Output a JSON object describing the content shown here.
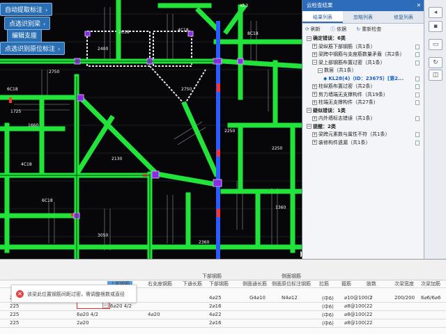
{
  "menu": {
    "items": [
      {
        "label": "自动提取标注",
        "chevron": true
      },
      {
        "label": "点选识别梁",
        "chevron": true
      },
      {
        "label": "编辑支座",
        "chevron": false
      },
      {
        "label": "点选识别原位标注",
        "chevron": true
      }
    ]
  },
  "cad": {
    "labels": [
      "KL3",
      "2400",
      "2750",
      "2750",
      "1360",
      "1725",
      "1660",
      "2130",
      "2250",
      "2250",
      "3050",
      "2360",
      "6C18",
      "4C18",
      "6C18",
      "2C18",
      "8C18",
      "4C18"
    ]
  },
  "panel": {
    "title": "云检查结果",
    "close": "✕",
    "tabs": [
      "结果列表",
      "忽略列表",
      "修复列表"
    ],
    "toolbar": {
      "refresh": "刷新",
      "basis": "依据",
      "recheck": "重新检查"
    },
    "tree": [
      {
        "level": 0,
        "label": "确定错误：6类",
        "bold": true,
        "exp": "−"
      },
      {
        "level": 1,
        "label": "梁纵筋下部钢筋（共1条）",
        "exp": "+"
      },
      {
        "level": 1,
        "label": "梁跨中钢筋与支座筋数量矛盾（共2条）",
        "exp": "+"
      },
      {
        "level": 1,
        "label": "梁上部钢筋布置过密（共1条）",
        "exp": "−"
      },
      {
        "level": 2,
        "label": "数层（共1条）",
        "exp": "−"
      },
      {
        "level": 3,
        "label": "KL28(4)（ID：23675）[第2...",
        "selected": true
      },
      {
        "level": 1,
        "label": "柱纵筋布置过密（共2条）",
        "exp": "+"
      },
      {
        "level": 1,
        "label": "剪力墙端无支撑构件（共19条）",
        "exp": "+"
      },
      {
        "level": 1,
        "label": "柱端无支撑构件（共27条）",
        "exp": "+"
      },
      {
        "level": 0,
        "label": "疑似错误：1类",
        "bold": true,
        "exp": "−"
      },
      {
        "level": 1,
        "label": "内外墙标志错误（共1条）",
        "exp": "+"
      },
      {
        "level": 0,
        "label": "提醒：2类",
        "bold": true,
        "exp": "−"
      },
      {
        "level": 1,
        "label": "梁跨元素数与属性不符（共1条）",
        "exp": "+"
      },
      {
        "level": 1,
        "label": "装修构件遗漏（共1条）",
        "exp": "+"
      }
    ]
  },
  "table": {
    "group_headers": [
      "下部钢筋",
      "侧面钢筋"
    ],
    "headers": [
      "上部钢筋",
      "右支座钢筋",
      "下通长筋",
      "下部钢筋",
      "侧面通长筋",
      "侧面原位标注钢筋",
      "拉筋",
      "箍筋",
      "肢数",
      "次梁宽度",
      "次梁加筋"
    ],
    "error_message": "该梁此位置钢筋间距过密，需调整根数或直径",
    "rows": [
      {
        "c0": "225",
        "c1": "",
        "c2": "6⌀20 5/3",
        "c3": "",
        "c4": "4⌀25",
        "c5": "G4⌀10",
        "c6": "N4⌀12",
        "c7": "(中6)",
        "c8": "⌀10@100(2",
        "c9": "2",
        "c10": "200/200",
        "c11": "6⌀6/6⌀6"
      },
      {
        "c0": "225",
        "c1": "",
        "c2": "6⌀20 4/2",
        "c3": "",
        "c4": "2⌀16",
        "c5": "",
        "c6": "",
        "c7": "(中6)",
        "c8": "⌀8@100(2",
        "c9": "2",
        "c10": "",
        "c11": ""
      },
      {
        "c0": "225",
        "c1": "6⌀20 4/2",
        "c2": "",
        "c3": "4⌀20",
        "c4": "4⌀22",
        "c5": "",
        "c6": "",
        "c7": "(中6)",
        "c8": "⌀8@100(2",
        "c9": "2",
        "c10": "",
        "c11": ""
      },
      {
        "c0": "225",
        "c1": "2⌀20",
        "c2": "",
        "c3": "",
        "c4": "2⌀16",
        "c5": "",
        "c6": "",
        "c7": "(中6)",
        "c8": "⌀8@100(2",
        "c9": "2",
        "c10": "",
        "c11": ""
      }
    ]
  },
  "colors": {
    "beam": "#22e33a",
    "beam_dark": "#0d7a1e",
    "column": "#8a2be2",
    "selected_beam": "#2a5cff",
    "panel_title": "#2d6cb8",
    "error": "#e04848"
  }
}
